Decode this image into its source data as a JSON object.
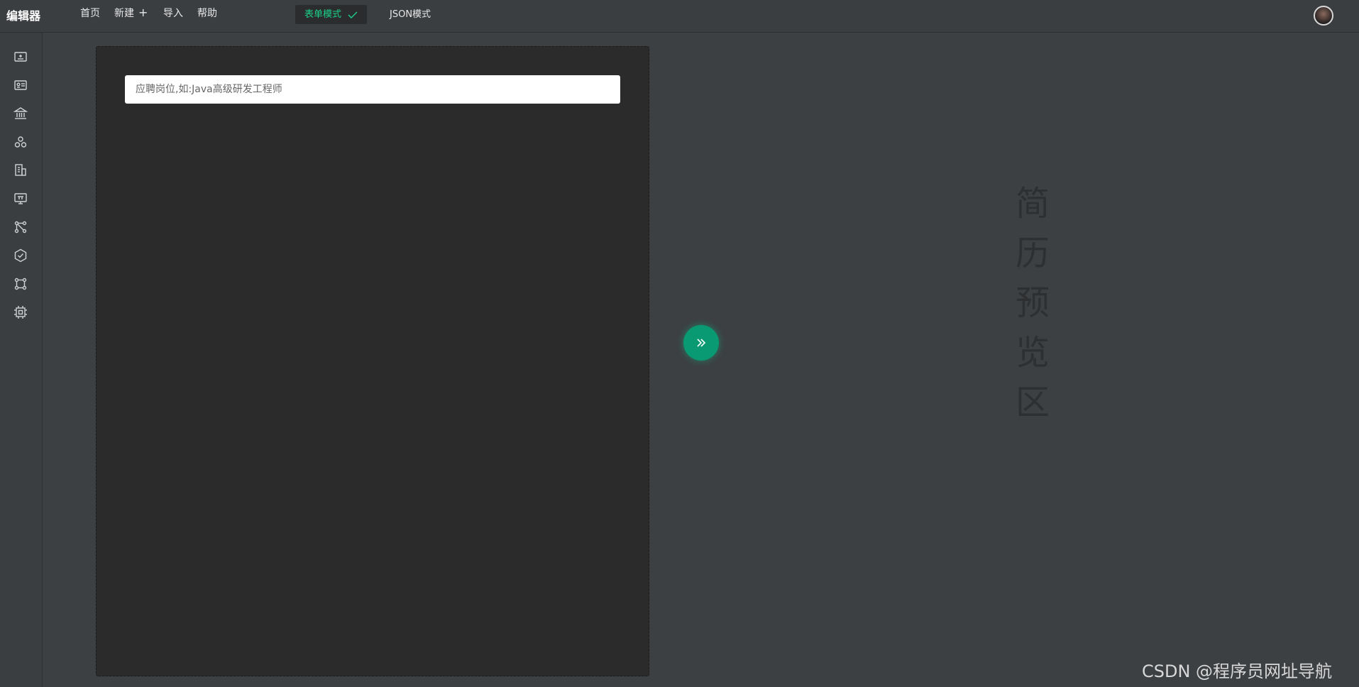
{
  "header": {
    "logo": "编辑器",
    "nav": [
      {
        "label": "首页"
      },
      {
        "label": "新建",
        "icon": "plus-icon"
      },
      {
        "label": "导入"
      },
      {
        "label": "帮助"
      }
    ],
    "modes": {
      "form": "表单模式",
      "json": "JSON模式",
      "active": "form",
      "active_color": "#1bd18b"
    }
  },
  "sidebar": {
    "icons": [
      "personal-info-icon",
      "id-card-icon",
      "school-icon",
      "skills-icon",
      "company-icon",
      "project-icon",
      "network-icon",
      "settings-icon",
      "modules-icon",
      "chip-icon"
    ]
  },
  "editor": {
    "job_placeholder": "应聘岗位,如:Java高级研发工程师"
  },
  "preview": {
    "label_chars": [
      "简",
      "历",
      "预",
      "览",
      "区"
    ]
  },
  "watermark": "CSDN @程序员网址导航",
  "colors": {
    "accent": "#0a9a73",
    "background": "#3d4043",
    "editor_bg": "#2b2b2b"
  }
}
